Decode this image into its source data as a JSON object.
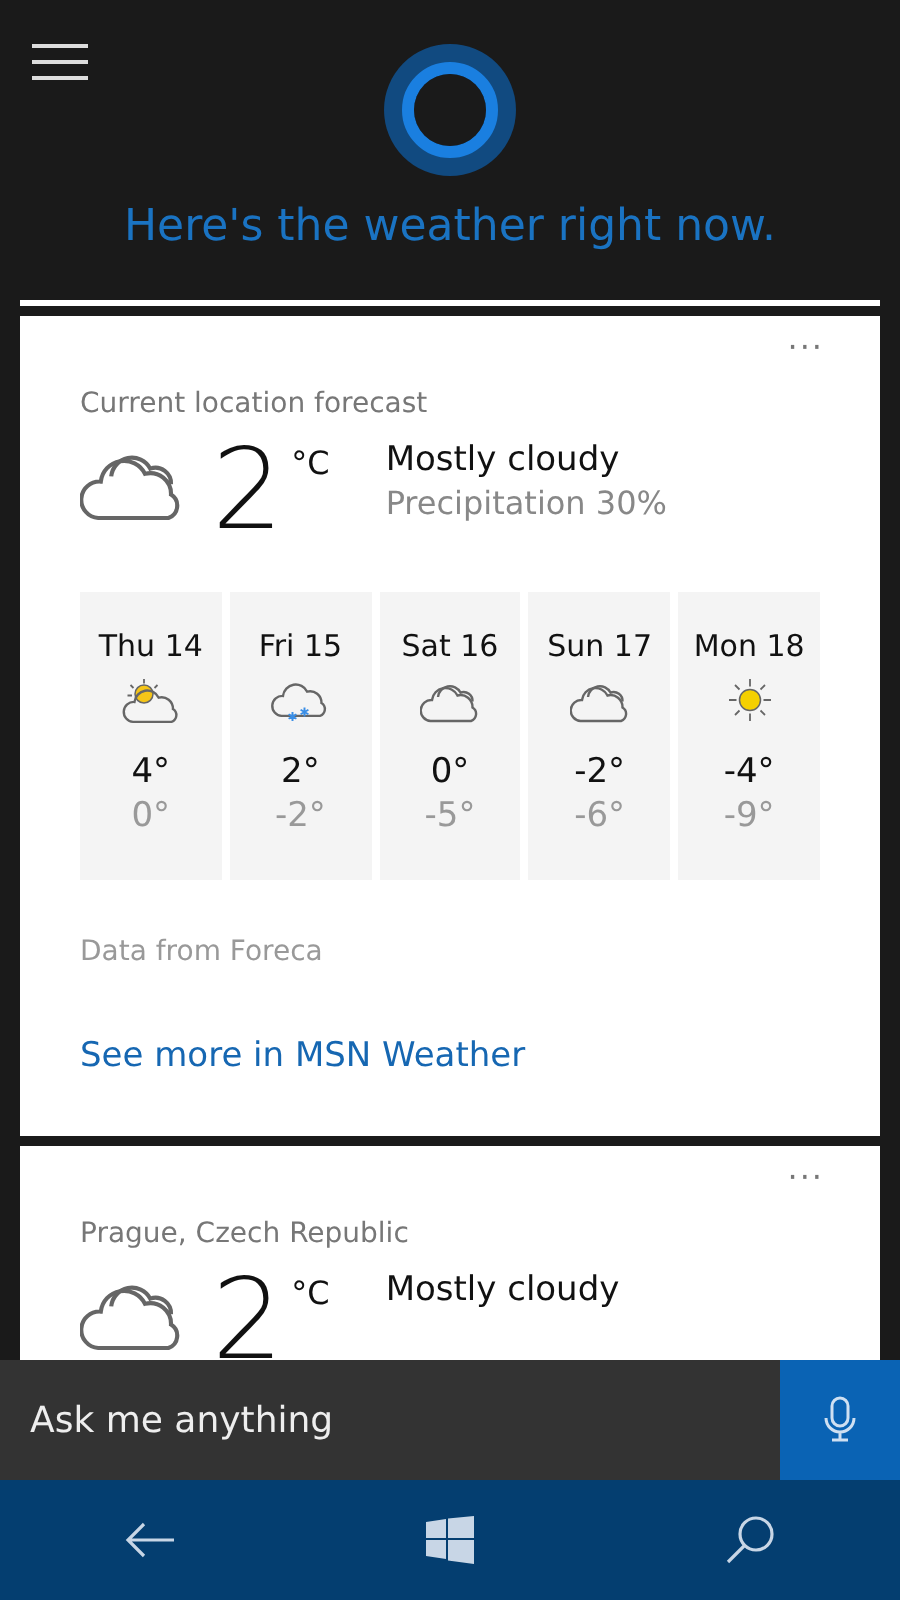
{
  "header": {
    "prompt": "Here's the weather right now."
  },
  "cards": [
    {
      "title": "Current location forecast",
      "more": "···",
      "temperature": "2",
      "unit": "°C",
      "condition": "Mostly cloudy",
      "kind": "cloudy",
      "precipitation": "Precipitation 30%",
      "forecast": [
        {
          "day": "Thu 14",
          "kind": "partly-sunny",
          "high": "4°",
          "low": "0°"
        },
        {
          "day": "Fri 15",
          "kind": "snow",
          "high": "2°",
          "low": "-2°"
        },
        {
          "day": "Sat 16",
          "kind": "cloudy",
          "high": "0°",
          "low": "-5°"
        },
        {
          "day": "Sun 17",
          "kind": "cloudy",
          "high": "-2°",
          "low": "-6°"
        },
        {
          "day": "Mon 18",
          "kind": "sunny",
          "high": "-4°",
          "low": "-9°"
        }
      ],
      "source": "Data from Foreca",
      "link": "See more in MSN Weather"
    },
    {
      "title": "Prague, Czech Republic",
      "more": "···",
      "temperature": "2",
      "unit": "°C",
      "condition": "Mostly cloudy",
      "kind": "cloudy"
    }
  ],
  "search": {
    "placeholder": "Ask me anything"
  }
}
